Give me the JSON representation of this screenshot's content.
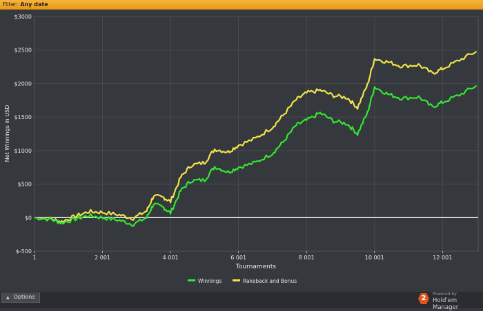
{
  "filter": {
    "label": "Filter:",
    "value": "Any date"
  },
  "options": {
    "label": "Options"
  },
  "branding": {
    "badge": "2",
    "powered": "Powered by",
    "name": "Hold'em Manager",
    "badge_color": "#e0551d"
  },
  "colors": {
    "background": "#35383c",
    "grid": "#4b4f54",
    "zero_line": "#ffffff",
    "winnings": "#33e633",
    "rakeback": "#f2e34a"
  },
  "chart_data": {
    "type": "line",
    "xlabel": "Tournaments",
    "ylabel": "Net Winnings in USD",
    "xlim": [
      1,
      13050
    ],
    "ylim": [
      -500,
      3000
    ],
    "x_ticks": [
      1,
      2001,
      4001,
      6001,
      8001,
      10001,
      12001
    ],
    "x_tick_labels": [
      "1",
      "2 001",
      "4 001",
      "6 001",
      "8 001",
      "10 001",
      "12 001"
    ],
    "y_ticks": [
      -500,
      0,
      500,
      1000,
      1500,
      2000,
      2500,
      3000
    ],
    "y_tick_labels": [
      "$-500",
      "$0",
      "$500",
      "$1000",
      "$1500",
      "$2000",
      "$2500",
      "$3000"
    ],
    "grid": true,
    "legend_position": "bottom-center",
    "x": [
      1,
      500,
      800,
      1200,
      1600,
      2001,
      2500,
      2900,
      3300,
      3500,
      3800,
      4001,
      4300,
      4600,
      5000,
      5300,
      5700,
      6001,
      6500,
      7000,
      7300,
      7700,
      8001,
      8400,
      8800,
      9200,
      9500,
      9800,
      10001,
      10400,
      10800,
      11300,
      11700,
      12001,
      12500,
      13000
    ],
    "series": [
      {
        "name": "Winnings",
        "color": "#33e633",
        "values": [
          0,
          -30,
          -80,
          -20,
          30,
          0,
          -40,
          -100,
          0,
          200,
          150,
          70,
          400,
          550,
          560,
          760,
          680,
          750,
          820,
          960,
          1120,
          1380,
          1450,
          1560,
          1440,
          1400,
          1250,
          1570,
          1950,
          1840,
          1780,
          1800,
          1650,
          1720,
          1830,
          1970
        ]
      },
      {
        "name": "Rakeback and Bonus",
        "color": "#f2e34a",
        "values": [
          0,
          -20,
          -60,
          20,
          90,
          80,
          40,
          -10,
          100,
          320,
          300,
          240,
          600,
          780,
          820,
          1020,
          980,
          1080,
          1180,
          1350,
          1520,
          1760,
          1860,
          1900,
          1820,
          1790,
          1640,
          1990,
          2370,
          2320,
          2260,
          2280,
          2150,
          2220,
          2350,
          2480
        ]
      }
    ]
  }
}
